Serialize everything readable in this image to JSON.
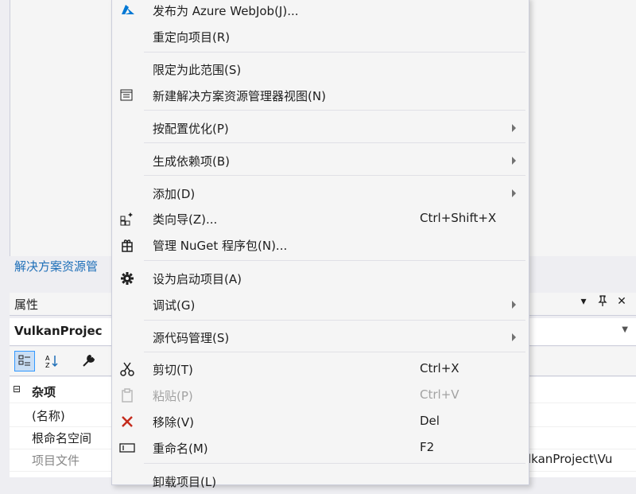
{
  "solution_explorer": {
    "tab_label": "解决方案资源管"
  },
  "properties": {
    "title": "属性",
    "object_name": "VulkanProjec",
    "category": "杂项",
    "rows": [
      {
        "name": "(名称)",
        "value": ""
      },
      {
        "name": "根命名空间",
        "value": ""
      },
      {
        "name": "项目文件",
        "value": "lkanProject\\Vu"
      }
    ]
  },
  "context_menu": {
    "items": [
      {
        "label": "发布为 Azure WebJob(J)...",
        "shortcut": "",
        "icon": "azure-icon",
        "submenu": false,
        "enabled": true
      },
      {
        "label": "重定向项目(R)",
        "shortcut": "",
        "icon": "",
        "submenu": false,
        "enabled": true
      },
      {
        "label": "限定为此范围(S)",
        "shortcut": "",
        "icon": "",
        "submenu": false,
        "enabled": true
      },
      {
        "label": "新建解决方案资源管理器视图(N)",
        "shortcut": "",
        "icon": "new-view-icon",
        "submenu": false,
        "enabled": true
      },
      {
        "label": "按配置优化(P)",
        "shortcut": "",
        "icon": "",
        "submenu": true,
        "enabled": true
      },
      {
        "label": "生成依赖项(B)",
        "shortcut": "",
        "icon": "",
        "submenu": true,
        "enabled": true
      },
      {
        "label": "添加(D)",
        "shortcut": "",
        "icon": "",
        "submenu": true,
        "enabled": true
      },
      {
        "label": "类向导(Z)...",
        "shortcut": "Ctrl+Shift+X",
        "icon": "class-wizard-icon",
        "submenu": false,
        "enabled": true
      },
      {
        "label": "管理 NuGet 程序包(N)...",
        "shortcut": "",
        "icon": "nuget-icon",
        "submenu": false,
        "enabled": true
      },
      {
        "label": "设为启动项目(A)",
        "shortcut": "",
        "icon": "gear-icon",
        "submenu": false,
        "enabled": true
      },
      {
        "label": "调试(G)",
        "shortcut": "",
        "icon": "",
        "submenu": true,
        "enabled": true
      },
      {
        "label": "源代码管理(S)",
        "shortcut": "",
        "icon": "",
        "submenu": true,
        "enabled": true
      },
      {
        "label": "剪切(T)",
        "shortcut": "Ctrl+X",
        "icon": "scissors-icon",
        "submenu": false,
        "enabled": true
      },
      {
        "label": "粘贴(P)",
        "shortcut": "Ctrl+V",
        "icon": "paste-icon",
        "submenu": false,
        "enabled": false
      },
      {
        "label": "移除(V)",
        "shortcut": "Del",
        "icon": "remove-icon",
        "submenu": false,
        "enabled": true
      },
      {
        "label": "重命名(M)",
        "shortcut": "F2",
        "icon": "rename-icon",
        "submenu": false,
        "enabled": true
      },
      {
        "label": "卸载项目(L)",
        "shortcut": "",
        "icon": "",
        "submenu": false,
        "enabled": true
      }
    ]
  },
  "colors": {
    "menu_bg": "#f5f5f5",
    "accent_link": "#1e6fb8",
    "remove_red": "#c42b1c",
    "azure_blue": "#0078d4"
  }
}
